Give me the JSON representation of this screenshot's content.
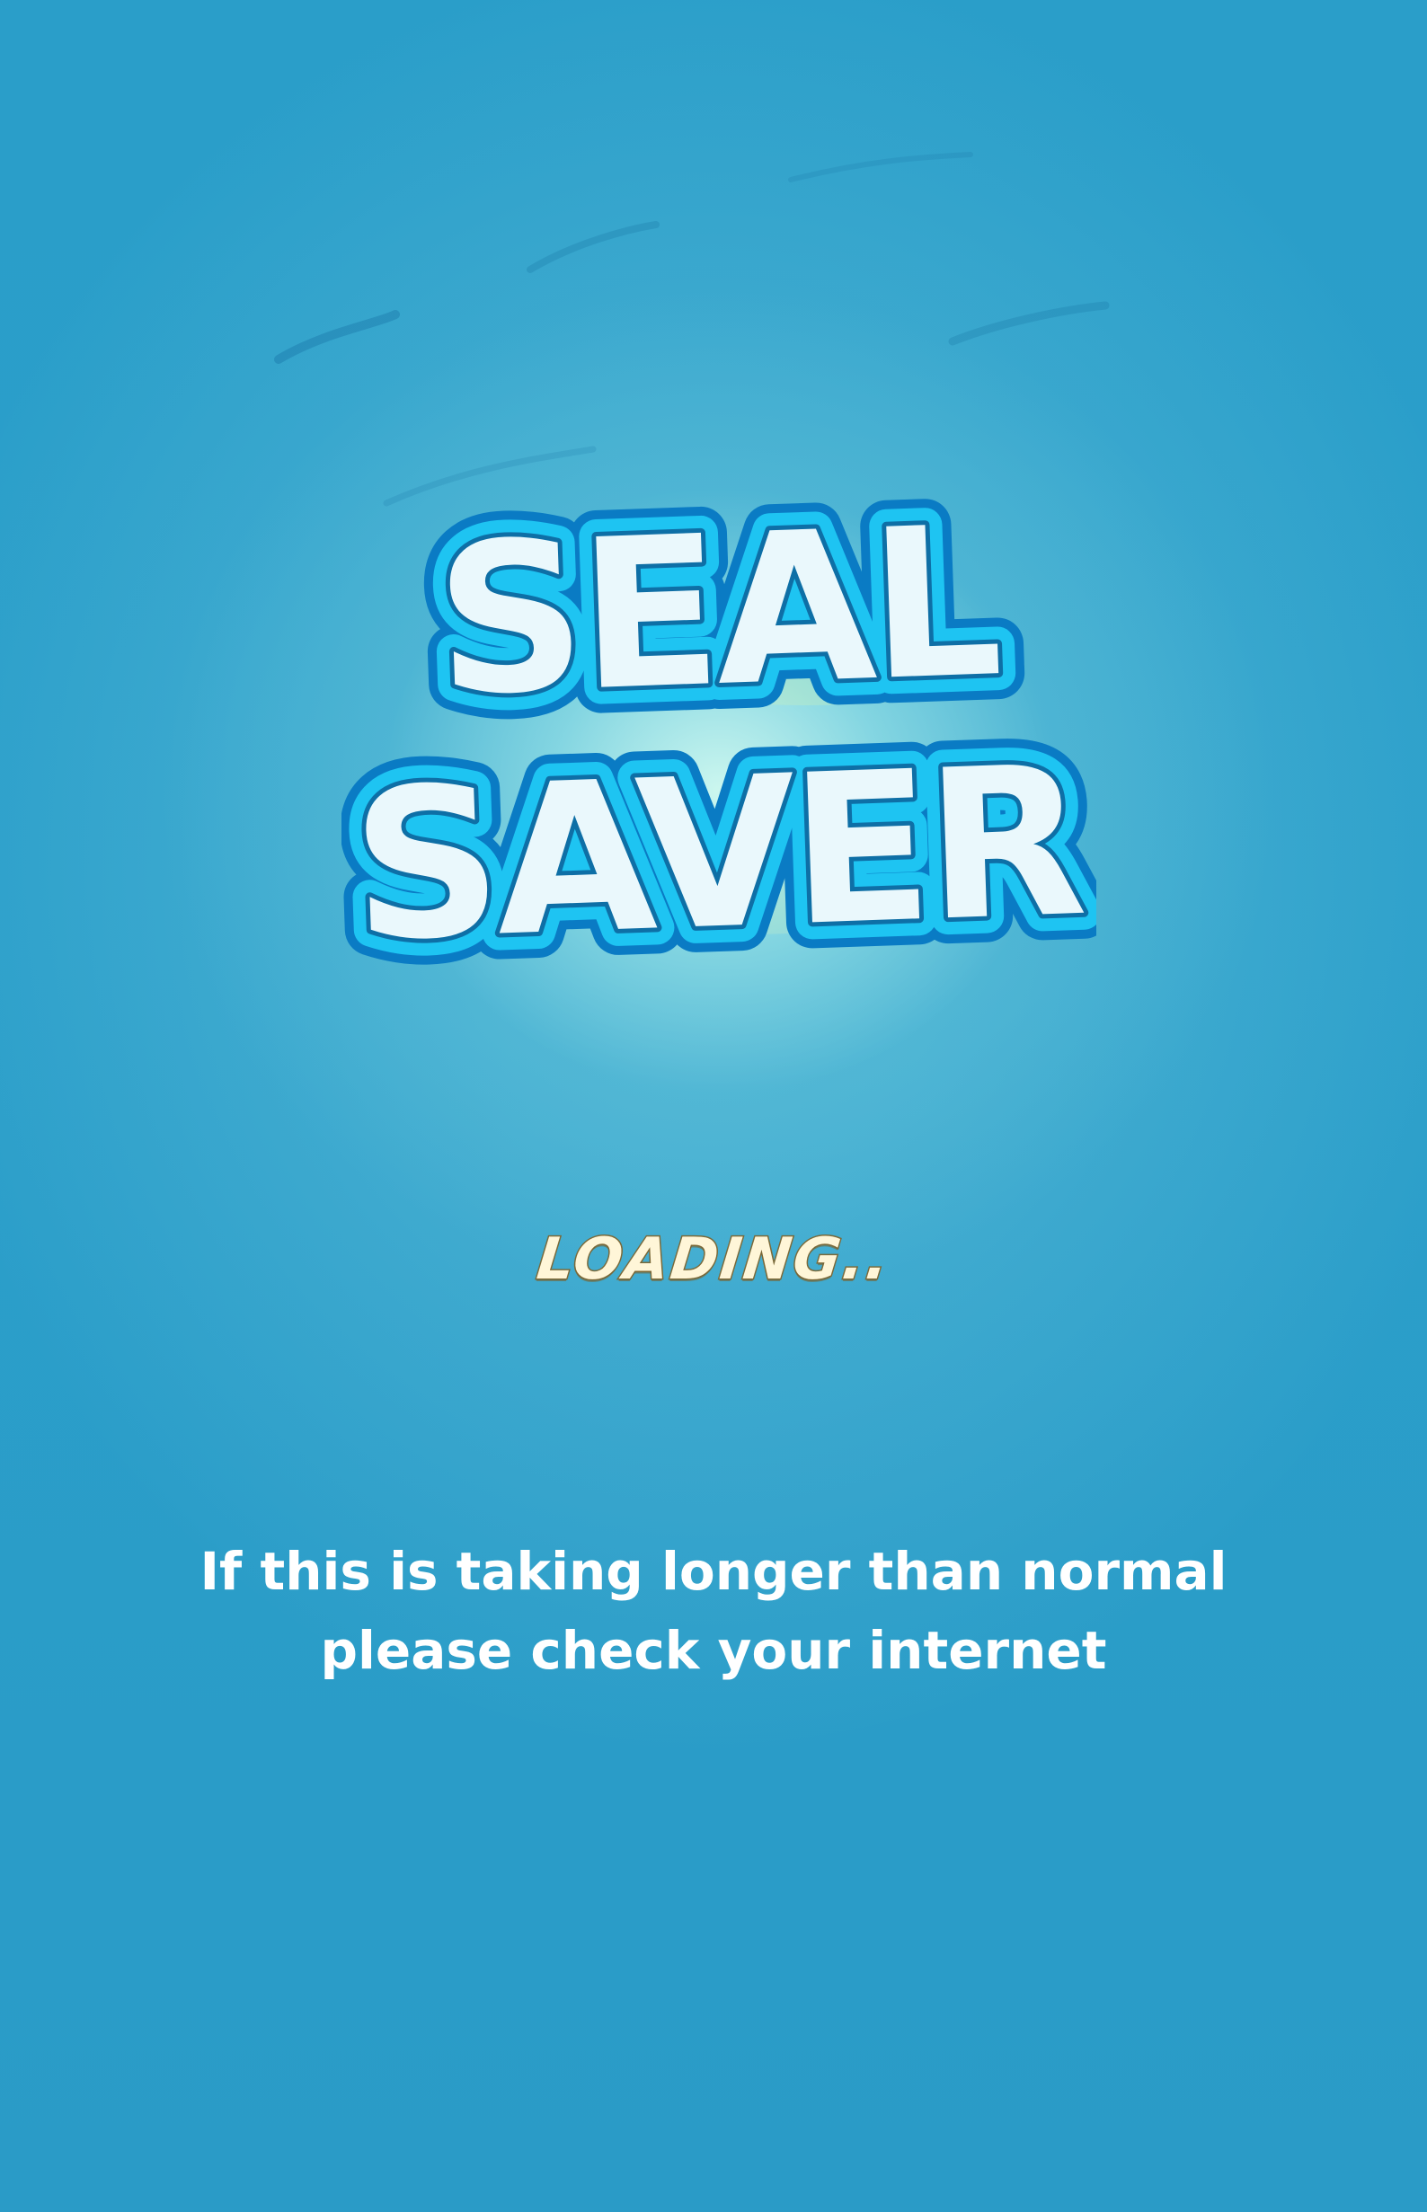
{
  "game": {
    "title_line1": "SEAL",
    "title_line2": "SAVER",
    "loading_label": "LOADING..",
    "notice_line1": "If this is taking longer than normal",
    "notice_line2": "please check your internet"
  },
  "colors": {
    "background": "#2a9cc8",
    "glow": "#d2faf0",
    "logo_fill": "#eaf8fc",
    "logo_outline": "#1ec4f2",
    "logo_outer_outline": "#0a7bc4",
    "loading_text": "#fff6d8",
    "notice_text": "#ffffff"
  }
}
